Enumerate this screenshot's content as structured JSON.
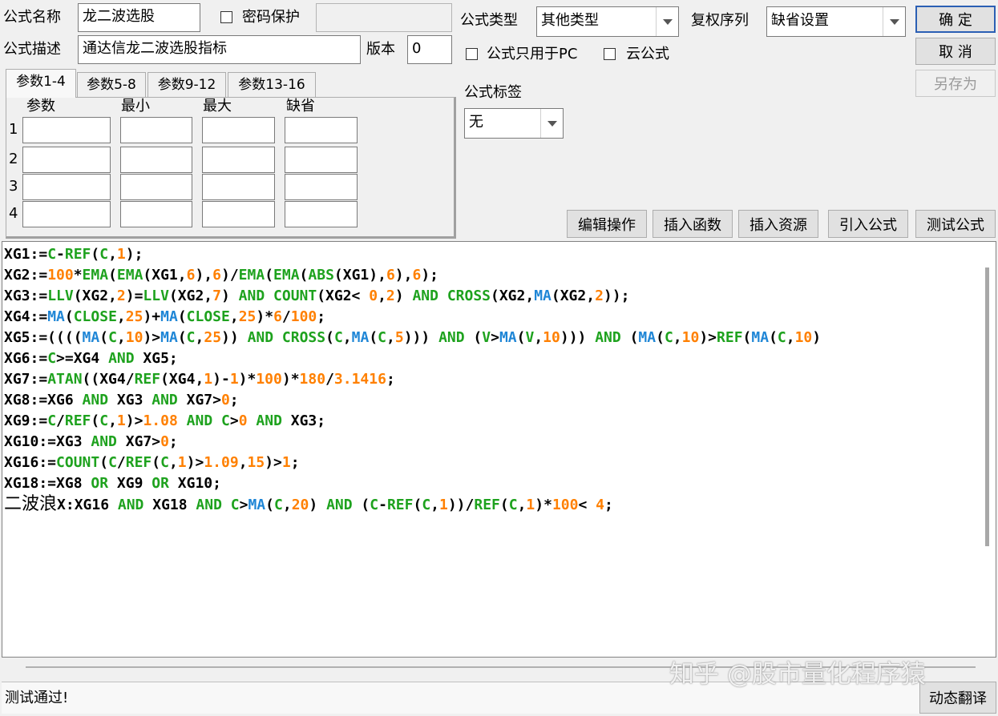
{
  "form": {
    "name_label": "公式名称",
    "name_value": "龙二波选股",
    "password_label": "密码保护",
    "password_checked": false,
    "password_value": "",
    "desc_label": "公式描述",
    "desc_value": "通达信龙二波选股指标",
    "version_label": "版本",
    "version_value": "0",
    "type_label": "公式类型",
    "type_value": "其他类型",
    "rights_label": "复权序列",
    "rights_value": "缺省设置",
    "pc_only_label": "公式只用于PC",
    "pc_only_checked": false,
    "cloud_label": "云公式",
    "cloud_checked": false,
    "tag_label": "公式标签",
    "tag_value": "无"
  },
  "buttons": {
    "ok": "确 定",
    "cancel": "取 消",
    "save_as": "另存为",
    "edit_ops": "编辑操作",
    "insert_func": "插入函数",
    "insert_res": "插入资源",
    "import_formula": "引入公式",
    "test_formula": "测试公式",
    "dynamic_translate": "动态翻译"
  },
  "tabs": [
    {
      "label": "参数1-4",
      "active": true
    },
    {
      "label": "参数5-8",
      "active": false
    },
    {
      "label": "参数9-12",
      "active": false
    },
    {
      "label": "参数13-16",
      "active": false
    }
  ],
  "params": {
    "headers": [
      "参数",
      "最小",
      "最大",
      "缺省"
    ],
    "rows": [
      "1",
      "2",
      "3",
      "4"
    ]
  },
  "colors": {
    "keyword": "#1ea21e",
    "number": "#ff8000",
    "function_blue": "#1f86d6",
    "text": "#000000"
  },
  "code_lines": [
    [
      [
        "XG1:=",
        "t"
      ],
      [
        "C",
        "k"
      ],
      [
        "-",
        "t"
      ],
      [
        "REF",
        "k"
      ],
      [
        "(",
        "t"
      ],
      [
        "C",
        "k"
      ],
      [
        ",",
        "t"
      ],
      [
        "1",
        "n"
      ],
      [
        ");",
        "t"
      ]
    ],
    [
      [
        "XG2:=",
        "t"
      ],
      [
        "100",
        "n"
      ],
      [
        "*",
        "t"
      ],
      [
        "EMA",
        "k"
      ],
      [
        "(",
        "t"
      ],
      [
        "EMA",
        "k"
      ],
      [
        "(XG1,",
        "t"
      ],
      [
        "6",
        "n"
      ],
      [
        "),",
        "t"
      ],
      [
        "6",
        "n"
      ],
      [
        ")/",
        "t"
      ],
      [
        "EMA",
        "k"
      ],
      [
        "(",
        "t"
      ],
      [
        "EMA",
        "k"
      ],
      [
        "(",
        "t"
      ],
      [
        "ABS",
        "k"
      ],
      [
        "(XG1),",
        "t"
      ],
      [
        "6",
        "n"
      ],
      [
        "),",
        "t"
      ],
      [
        "6",
        "n"
      ],
      [
        ");",
        "t"
      ]
    ],
    [
      [
        "XG3:=",
        "t"
      ],
      [
        "LLV",
        "k"
      ],
      [
        "(XG2,",
        "t"
      ],
      [
        "2",
        "n"
      ],
      [
        ")=",
        "t"
      ],
      [
        "LLV",
        "k"
      ],
      [
        "(XG2,",
        "t"
      ],
      [
        "7",
        "n"
      ],
      [
        ") ",
        "t"
      ],
      [
        "AND",
        "k"
      ],
      [
        " ",
        "t"
      ],
      [
        "COUNT",
        "k"
      ],
      [
        "(XG2< ",
        "t"
      ],
      [
        "0",
        "n"
      ],
      [
        ",",
        "t"
      ],
      [
        "2",
        "n"
      ],
      [
        ") ",
        "t"
      ],
      [
        "AND",
        "k"
      ],
      [
        " ",
        "t"
      ],
      [
        "CROSS",
        "k"
      ],
      [
        "(XG2,",
        "t"
      ],
      [
        "MA",
        "b"
      ],
      [
        "(XG2,",
        "t"
      ],
      [
        "2",
        "n"
      ],
      [
        "));",
        "t"
      ]
    ],
    [
      [
        "XG4:=",
        "t"
      ],
      [
        "MA",
        "b"
      ],
      [
        "(",
        "t"
      ],
      [
        "CLOSE",
        "k"
      ],
      [
        ",",
        "t"
      ],
      [
        "25",
        "n"
      ],
      [
        ")+",
        "t"
      ],
      [
        "MA",
        "b"
      ],
      [
        "(",
        "t"
      ],
      [
        "CLOSE",
        "k"
      ],
      [
        ",",
        "t"
      ],
      [
        "25",
        "n"
      ],
      [
        ")*",
        "t"
      ],
      [
        "6",
        "n"
      ],
      [
        "/",
        "t"
      ],
      [
        "100",
        "n"
      ],
      [
        ";",
        "t"
      ]
    ],
    [
      [
        "XG5:=((((",
        "t"
      ],
      [
        "MA",
        "b"
      ],
      [
        "(",
        "t"
      ],
      [
        "C",
        "k"
      ],
      [
        ",",
        "t"
      ],
      [
        "10",
        "n"
      ],
      [
        ")>",
        "t"
      ],
      [
        "MA",
        "b"
      ],
      [
        "(",
        "t"
      ],
      [
        "C",
        "k"
      ],
      [
        ",",
        "t"
      ],
      [
        "25",
        "n"
      ],
      [
        ")) ",
        "t"
      ],
      [
        "AND",
        "k"
      ],
      [
        " ",
        "t"
      ],
      [
        "CROSS",
        "k"
      ],
      [
        "(",
        "t"
      ],
      [
        "C",
        "k"
      ],
      [
        ",",
        "t"
      ],
      [
        "MA",
        "b"
      ],
      [
        "(",
        "t"
      ],
      [
        "C",
        "k"
      ],
      [
        ",",
        "t"
      ],
      [
        "5",
        "n"
      ],
      [
        "))) ",
        "t"
      ],
      [
        "AND",
        "k"
      ],
      [
        " (",
        "t"
      ],
      [
        "V",
        "k"
      ],
      [
        ">",
        "t"
      ],
      [
        "MA",
        "b"
      ],
      [
        "(",
        "t"
      ],
      [
        "V",
        "k"
      ],
      [
        ",",
        "t"
      ],
      [
        "10",
        "n"
      ],
      [
        "))) ",
        "t"
      ],
      [
        "AND",
        "k"
      ],
      [
        " (",
        "t"
      ],
      [
        "MA",
        "b"
      ],
      [
        "(",
        "t"
      ],
      [
        "C",
        "k"
      ],
      [
        ",",
        "t"
      ],
      [
        "10",
        "n"
      ],
      [
        ")>",
        "t"
      ],
      [
        "REF",
        "k"
      ],
      [
        "(",
        "t"
      ],
      [
        "MA",
        "b"
      ],
      [
        "(",
        "t"
      ],
      [
        "C",
        "k"
      ],
      [
        ",",
        "t"
      ],
      [
        "10",
        "n"
      ],
      [
        ")",
        "t"
      ]
    ],
    [
      [
        "XG6:=",
        "t"
      ],
      [
        "C",
        "k"
      ],
      [
        ">=XG4 ",
        "t"
      ],
      [
        "AND",
        "k"
      ],
      [
        " XG5;",
        "t"
      ]
    ],
    [
      [
        "XG7:=",
        "t"
      ],
      [
        "ATAN",
        "k"
      ],
      [
        "((XG4/",
        "t"
      ],
      [
        "REF",
        "k"
      ],
      [
        "(XG4,",
        "t"
      ],
      [
        "1",
        "n"
      ],
      [
        ")-",
        "t"
      ],
      [
        "1",
        "n"
      ],
      [
        ")*",
        "t"
      ],
      [
        "100",
        "n"
      ],
      [
        ")*",
        "t"
      ],
      [
        "180",
        "n"
      ],
      [
        "/",
        "t"
      ],
      [
        "3.1416",
        "n"
      ],
      [
        ";",
        "t"
      ]
    ],
    [
      [
        "XG8:=XG6 ",
        "t"
      ],
      [
        "AND",
        "k"
      ],
      [
        " XG3 ",
        "t"
      ],
      [
        "AND",
        "k"
      ],
      [
        " XG7>",
        "t"
      ],
      [
        "0",
        "n"
      ],
      [
        ";",
        "t"
      ]
    ],
    [
      [
        "XG9:=",
        "t"
      ],
      [
        "C",
        "k"
      ],
      [
        "/",
        "t"
      ],
      [
        "REF",
        "k"
      ],
      [
        "(",
        "t"
      ],
      [
        "C",
        "k"
      ],
      [
        ",",
        "t"
      ],
      [
        "1",
        "n"
      ],
      [
        ")>",
        "t"
      ],
      [
        "1.08",
        "n"
      ],
      [
        " ",
        "t"
      ],
      [
        "AND",
        "k"
      ],
      [
        " ",
        "t"
      ],
      [
        "C",
        "k"
      ],
      [
        ">",
        "t"
      ],
      [
        "0",
        "n"
      ],
      [
        " ",
        "t"
      ],
      [
        "AND",
        "k"
      ],
      [
        " XG3;",
        "t"
      ]
    ],
    [
      [
        "XG10:=XG3 ",
        "t"
      ],
      [
        "AND",
        "k"
      ],
      [
        " XG7>",
        "t"
      ],
      [
        "0",
        "n"
      ],
      [
        ";",
        "t"
      ]
    ],
    [
      [
        "XG16:=",
        "t"
      ],
      [
        "COUNT",
        "k"
      ],
      [
        "(",
        "t"
      ],
      [
        "C",
        "k"
      ],
      [
        "/",
        "t"
      ],
      [
        "REF",
        "k"
      ],
      [
        "(",
        "t"
      ],
      [
        "C",
        "k"
      ],
      [
        ",",
        "t"
      ],
      [
        "1",
        "n"
      ],
      [
        ")>",
        "t"
      ],
      [
        "1.09",
        "n"
      ],
      [
        ",",
        "t"
      ],
      [
        "15",
        "n"
      ],
      [
        ")>",
        "t"
      ],
      [
        "1",
        "n"
      ],
      [
        ";",
        "t"
      ]
    ],
    [
      [
        "XG18:=XG8 ",
        "t"
      ],
      [
        "OR",
        "k"
      ],
      [
        " XG9 ",
        "t"
      ],
      [
        "OR",
        "k"
      ],
      [
        " XG10;",
        "t"
      ]
    ],
    [
      [
        "二波浪",
        "p"
      ],
      [
        "X:XG16 ",
        "t"
      ],
      [
        "AND",
        "k"
      ],
      [
        " XG18 ",
        "t"
      ],
      [
        "AND",
        "k"
      ],
      [
        " ",
        "t"
      ],
      [
        "C",
        "k"
      ],
      [
        ">",
        "t"
      ],
      [
        "MA",
        "b"
      ],
      [
        "(",
        "t"
      ],
      [
        "C",
        "k"
      ],
      [
        ",",
        "t"
      ],
      [
        "20",
        "n"
      ],
      [
        ") ",
        "t"
      ],
      [
        "AND",
        "k"
      ],
      [
        " (",
        "t"
      ],
      [
        "C",
        "k"
      ],
      [
        "-",
        "t"
      ],
      [
        "REF",
        "k"
      ],
      [
        "(",
        "t"
      ],
      [
        "C",
        "k"
      ],
      [
        ",",
        "t"
      ],
      [
        "1",
        "n"
      ],
      [
        "))/",
        "t"
      ],
      [
        "REF",
        "k"
      ],
      [
        "(",
        "t"
      ],
      [
        "C",
        "k"
      ],
      [
        ",",
        "t"
      ],
      [
        "1",
        "n"
      ],
      [
        ")*",
        "t"
      ],
      [
        "100",
        "n"
      ],
      [
        "< ",
        "t"
      ],
      [
        "4",
        "n"
      ],
      [
        ";",
        "t"
      ]
    ]
  ],
  "status_text": "测试通过!",
  "watermark": "知乎 @股市量化程序猿"
}
